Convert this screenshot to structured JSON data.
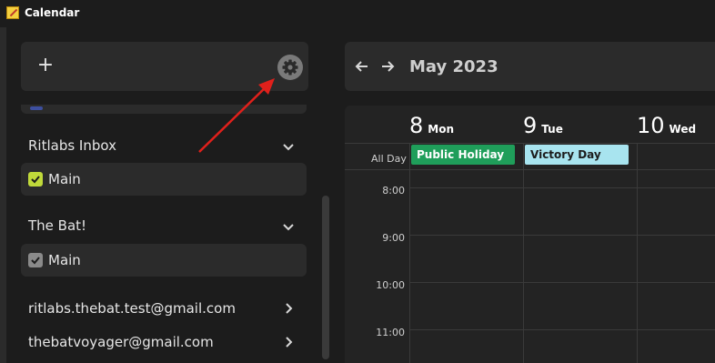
{
  "window": {
    "title": "Calendar",
    "app_icon": "calendar-app-icon"
  },
  "sidebar": {
    "add_label": "+",
    "settings_icon": "gear-icon",
    "groups": [
      {
        "name": "Ritlabs Inbox",
        "expanded": true,
        "calendars": [
          {
            "label": "Main",
            "checked": true,
            "color": "#c0d93a"
          }
        ]
      },
      {
        "name": "The Bat!",
        "expanded": true,
        "calendars": [
          {
            "label": "Main",
            "checked": true,
            "color": "#8a8a8a"
          }
        ]
      }
    ],
    "accounts": [
      {
        "label": "ritlabs.thebat.test@gmail.com",
        "expanded": false
      },
      {
        "label": "thebatvoyager@gmail.com",
        "expanded": false
      }
    ]
  },
  "calendar": {
    "month_title": "May 2023",
    "days": [
      {
        "num": "8",
        "name": "Mon"
      },
      {
        "num": "9",
        "name": "Tue"
      },
      {
        "num": "10",
        "name": "Wed"
      }
    ],
    "all_day_label": "All Day",
    "all_day_events": [
      {
        "title": "Public Holiday",
        "day": "Mon",
        "color": "#1f9e5a",
        "text_color": "#ffffff"
      },
      {
        "title": "Victory Day",
        "day": "Tue",
        "color": "#a8e4ef",
        "text_color": "#1c1c1c"
      }
    ],
    "hours": [
      "8:00",
      "9:00",
      "10:00",
      "11:00"
    ]
  },
  "annotation": {
    "type": "red-arrow",
    "points_to": "settings-gear-button",
    "color": "#e0201b"
  }
}
